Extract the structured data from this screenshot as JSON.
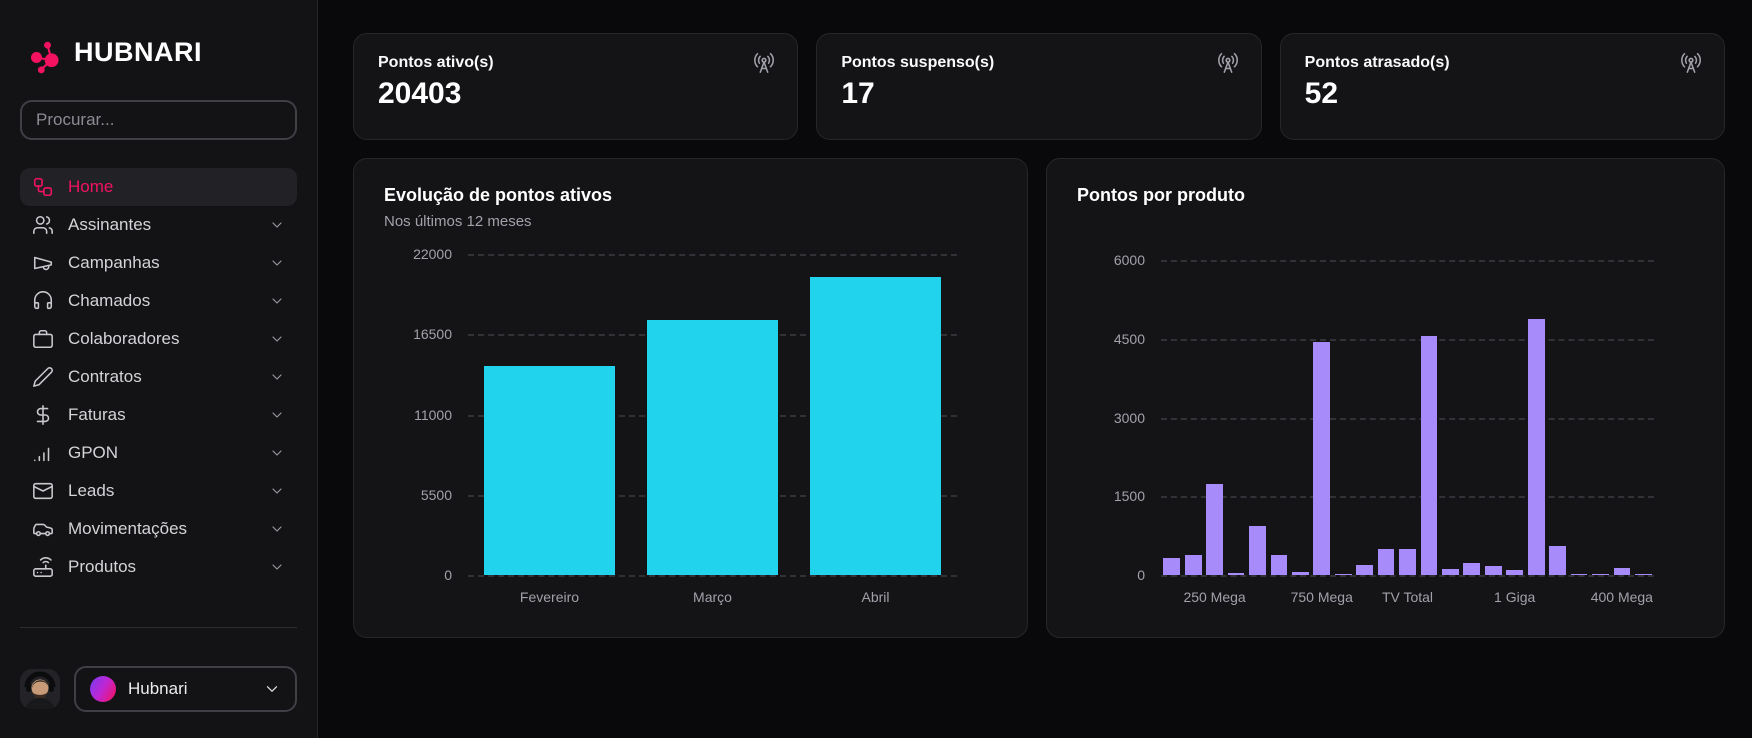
{
  "brand": {
    "name": "HUBNARI",
    "logo_color": "#f31260"
  },
  "sidebar": {
    "search_placeholder": "Procurar...",
    "items": [
      {
        "label": "Home",
        "icon": "workflow",
        "slug": "home",
        "active": true,
        "has_chevron": false
      },
      {
        "label": "Assinantes",
        "icon": "users",
        "slug": "assinantes",
        "active": false,
        "has_chevron": true
      },
      {
        "label": "Campanhas",
        "icon": "megaphone",
        "slug": "campanhas",
        "active": false,
        "has_chevron": true
      },
      {
        "label": "Chamados",
        "icon": "headset",
        "slug": "chamados",
        "active": false,
        "has_chevron": true
      },
      {
        "label": "Colaboradores",
        "icon": "briefcase",
        "slug": "colaboradores",
        "active": false,
        "has_chevron": true
      },
      {
        "label": "Contratos",
        "icon": "pencil",
        "slug": "contratos",
        "active": false,
        "has_chevron": true
      },
      {
        "label": "Faturas",
        "icon": "dollar",
        "slug": "faturas",
        "active": false,
        "has_chevron": true
      },
      {
        "label": "GPON",
        "icon": "signal",
        "slug": "gpon",
        "active": false,
        "has_chevron": true
      },
      {
        "label": "Leads",
        "icon": "mail",
        "slug": "leads",
        "active": false,
        "has_chevron": true
      },
      {
        "label": "Movimentações",
        "icon": "car",
        "slug": "movimentacoes",
        "active": false,
        "has_chevron": true
      },
      {
        "label": "Produtos",
        "icon": "router",
        "slug": "produtos",
        "active": false,
        "has_chevron": true
      }
    ],
    "user": {
      "name": "Hubnari"
    }
  },
  "stats": [
    {
      "label": "Pontos ativo(s)",
      "value": "20403",
      "icon": "radio-tower"
    },
    {
      "label": "Pontos suspenso(s)",
      "value": "17",
      "icon": "radio-tower"
    },
    {
      "label": "Pontos atrasado(s)",
      "value": "52",
      "icon": "radio-tower"
    }
  ],
  "chart_data": [
    {
      "type": "bar",
      "title": "Evolução de pontos ativos",
      "subtitle": "Nos últimos 12 meses",
      "categories": [
        "Fevereiro",
        "Março",
        "Abril"
      ],
      "values": [
        14300,
        17500,
        20403
      ],
      "ylim": [
        0,
        22000
      ],
      "yticks": [
        0,
        5500,
        11000,
        16500,
        22000
      ],
      "bar_color": "#22d3ee",
      "bar_width_pct": 80,
      "grid": "horizontal-dashed",
      "tick_labels": [
        {
          "text": "Fevereiro",
          "slot": 0
        },
        {
          "text": "Março",
          "slot": 1
        },
        {
          "text": "Abril",
          "slot": 2
        }
      ]
    },
    {
      "type": "bar",
      "title": "Pontos por produto",
      "subtitle": "",
      "values": [
        320,
        380,
        1730,
        30,
        930,
        380,
        60,
        4430,
        20,
        200,
        490,
        500,
        4560,
        110,
        230,
        170,
        105,
        4880,
        560,
        20,
        15,
        130,
        10
      ],
      "ylim": [
        0,
        6000
      ],
      "yticks": [
        0,
        1500,
        3000,
        4500,
        6000
      ],
      "bar_color": "#a78bfa",
      "bar_width_pct": 78,
      "grid": "horizontal-dashed",
      "tick_labels": [
        {
          "text": "250 Mega",
          "slot": 2
        },
        {
          "text": "750 Mega",
          "slot": 7
        },
        {
          "text": "TV Total",
          "slot": 11
        },
        {
          "text": "1 Giga",
          "slot": 16
        },
        {
          "text": "400 Mega",
          "slot": 21
        }
      ]
    }
  ]
}
